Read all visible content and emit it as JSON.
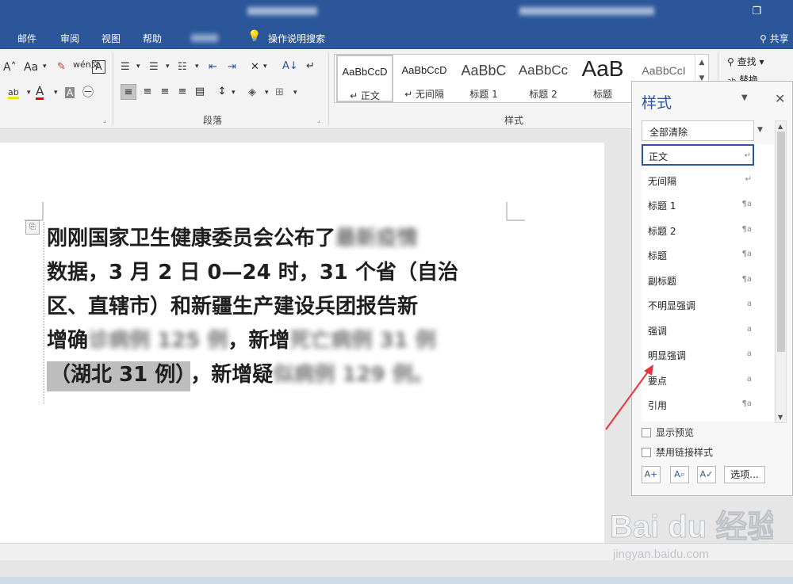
{
  "tabs": [
    "邮件",
    "审阅",
    "视图",
    "帮助"
  ],
  "tell_me": "操作说明搜索",
  "share": "共享",
  "ribbon": {
    "font_grow": "A˄",
    "change_case": "Aa",
    "phonetic": "wén文",
    "char_border": "A",
    "highlight": "ab",
    "font_color": "A",
    "char_shading": "A",
    "enclose": "㊀",
    "paragraph_label": "段落",
    "styles_label": "样式",
    "find_label": "查找",
    "replace_label": "替换"
  },
  "gallery": [
    {
      "sample": "AaBbCcD",
      "name": "↵ 正文"
    },
    {
      "sample": "AaBbCcD",
      "name": "↵ 无间隔"
    },
    {
      "sample": "AaBbC",
      "name": "标题 1"
    },
    {
      "sample": "AaBbCc",
      "name": "标题 2"
    },
    {
      "sample": "AaB",
      "name": "标题"
    },
    {
      "sample": "AaBbCcI",
      "name": ""
    }
  ],
  "document": {
    "lines": [
      {
        "text": "刚刚国家卫生健康委员会公布了",
        "blur": "最新疫情"
      },
      {
        "text": "数据，3 月 2 日 0—24 时，31 个省（自治"
      },
      {
        "text": "区、直辖市）和新疆生产建设兵团报告新"
      },
      {
        "pre": "增确",
        "blur1": "诊病例 125 例",
        "mid": "，新增",
        "blur2": "死亡病例 31 例"
      },
      {
        "hl": "（湖北 31 例）",
        "mid": "，新增疑",
        "blur": "似病例 129 例。"
      }
    ]
  },
  "styles_pane": {
    "title": "样式",
    "clear_all": "全部清除",
    "items": [
      {
        "name": "正文",
        "symbol": "↵"
      },
      {
        "name": "无间隔",
        "symbol": "↵"
      },
      {
        "name": "标题 1",
        "symbol": "¶a"
      },
      {
        "name": "标题 2",
        "symbol": "¶a"
      },
      {
        "name": "标题",
        "symbol": "¶a"
      },
      {
        "name": "副标题",
        "symbol": "¶a"
      },
      {
        "name": "不明显强调",
        "symbol": "a"
      },
      {
        "name": "强调",
        "symbol": "a"
      },
      {
        "name": "明显强调",
        "symbol": "a"
      },
      {
        "name": "要点",
        "symbol": "a"
      },
      {
        "name": "引用",
        "symbol": "¶a"
      }
    ],
    "show_preview": "显示预览",
    "disable_linked": "禁用链接样式",
    "options": "选项..."
  },
  "watermark": {
    "brand": "Bai du 经验",
    "url": "jingyan.baidu.com"
  }
}
